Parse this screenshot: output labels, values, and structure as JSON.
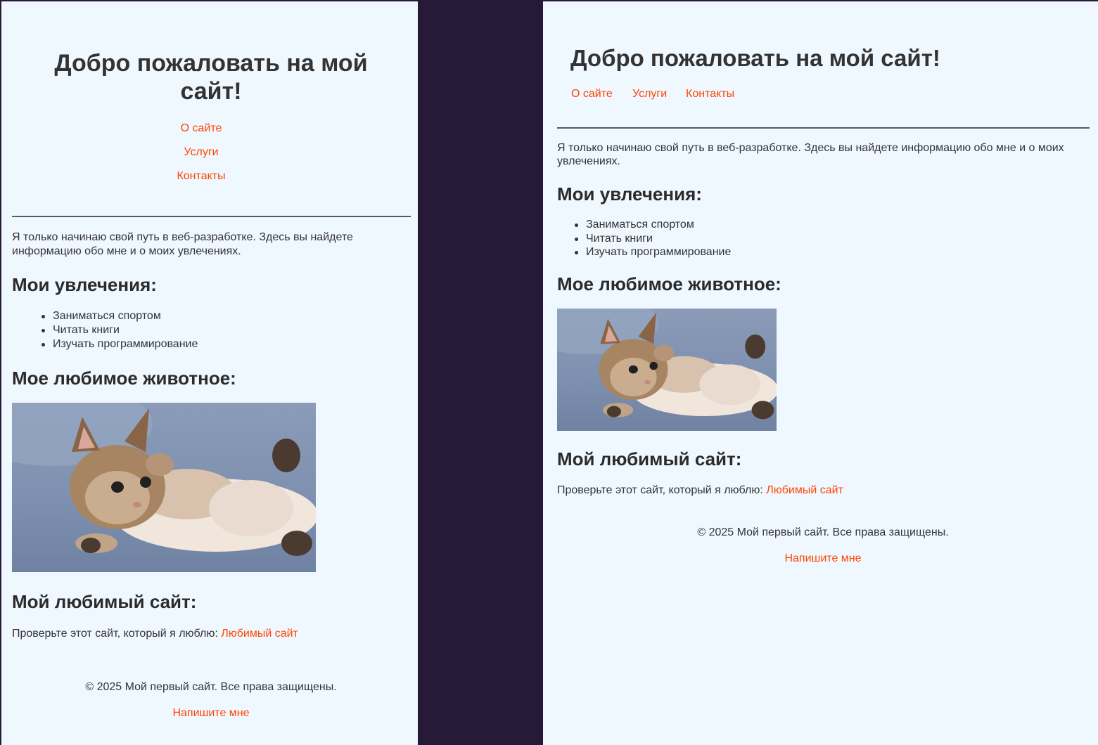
{
  "colors": {
    "page_background": "#f0f8ff",
    "divider_background": "#271938",
    "link": "#ff4500",
    "text": "#333333"
  },
  "site": {
    "title": "Добро пожаловать на мой сайт!",
    "nav": [
      "О сайте",
      "Услуги",
      "Контакты"
    ],
    "intro": "Я только начинаю свой путь в веб-разработке. Здесь вы найдете информацию обо мне и о моих увлечениях.",
    "hobbies_heading": "Мои увлечения:",
    "hobbies": [
      "Заниматься спортом",
      "Читать книги",
      "Изучать программирование"
    ],
    "animal_heading": "Мое любимое животное:",
    "favorite_site_heading": "Мой любимый сайт:",
    "favorite_site_text": "Проверьте этот сайт, который я люблю:",
    "favorite_site_link": "Любимый сайт",
    "footer_text": "© 2025 Мой первый сайт. Все права защищены.",
    "footer_link": "Напишите мне"
  }
}
